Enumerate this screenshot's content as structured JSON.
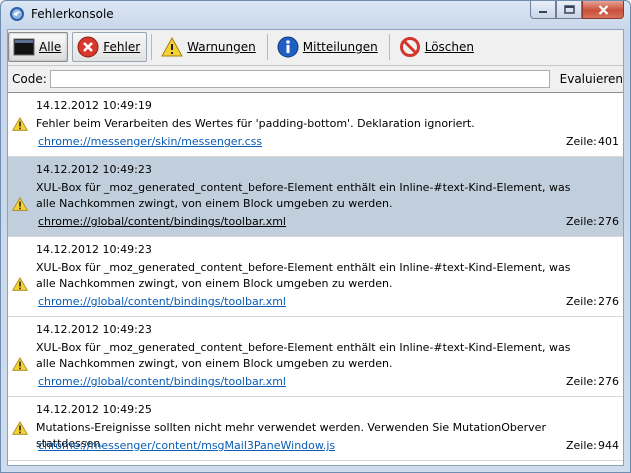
{
  "window": {
    "title": "Fehlerkonsole"
  },
  "toolbar": {
    "buttons": [
      {
        "label": "Alle",
        "icon": "all-icon"
      },
      {
        "label": "Fehler",
        "icon": "error-icon"
      },
      {
        "label": "Warnungen",
        "icon": "warning-icon"
      },
      {
        "label": "Mitteilungen",
        "icon": "info-icon"
      },
      {
        "label": "Löschen",
        "icon": "clear-icon"
      }
    ]
  },
  "code": {
    "label": "Code:",
    "value": "",
    "evaluate_label": "Evaluieren"
  },
  "line_label": "Zeile:",
  "entries": [
    {
      "timestamp": "14.12.2012 10:49:19",
      "message": "Fehler beim Verarbeiten des Wertes für 'padding-bottom'.  Deklaration ignoriert.",
      "source": "chrome://messenger/skin/messenger.css",
      "line": "401"
    },
    {
      "timestamp": "14.12.2012 10:49:23",
      "message": "XUL-Box für _moz_generated_content_before-Element enthält ein Inline-#text-Kind-Element, was alle Nachkommen zwingt, von einem Block umgeben zu werden.",
      "source": "chrome://global/content/bindings/toolbar.xml",
      "line": "276",
      "selected": true
    },
    {
      "timestamp": "14.12.2012 10:49:23",
      "message": "XUL-Box für _moz_generated_content_before-Element enthält ein Inline-#text-Kind-Element, was alle Nachkommen zwingt, von einem Block umgeben zu werden.",
      "source": "chrome://global/content/bindings/toolbar.xml",
      "line": "276"
    },
    {
      "timestamp": "14.12.2012 10:49:23",
      "message": "XUL-Box für _moz_generated_content_before-Element enthält ein Inline-#text-Kind-Element, was alle Nachkommen zwingt, von einem Block umgeben zu werden.",
      "source": "chrome://global/content/bindings/toolbar.xml",
      "line": "276"
    },
    {
      "timestamp": "14.12.2012 10:49:25",
      "message": "Mutations-Ereignisse sollten nicht mehr verwendet werden. Verwenden Sie MutationOberver stattdessen.",
      "source": "chrome://messenger/content/msgMail3PaneWindow.js",
      "line": "944"
    }
  ]
}
